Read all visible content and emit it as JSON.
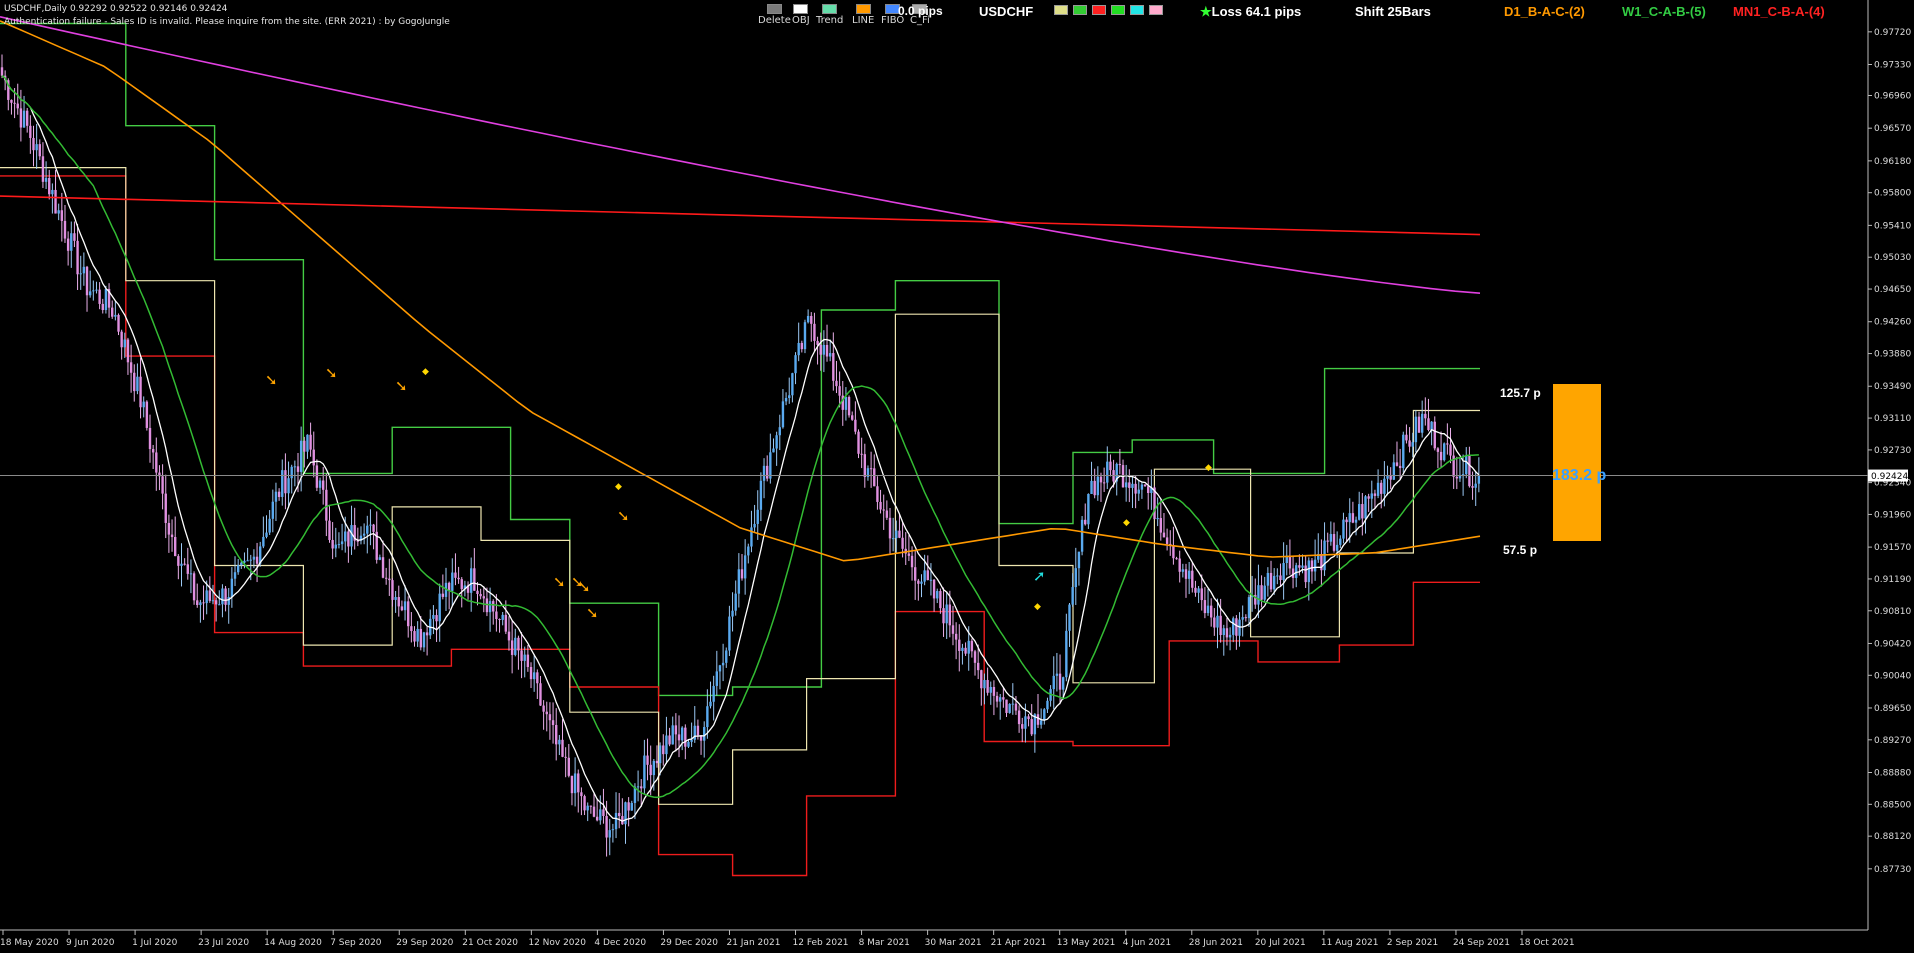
{
  "header": {
    "symbol_line": "USDCHF,Daily  0.92292 0.92522 0.92146 0.92424",
    "auth_message": "Authentication failure - Sales ID is invalid. Please inquire from the site. (ERR 2021) : by GogoJungle"
  },
  "toolbar": {
    "tools": [
      {
        "label": "Delete",
        "color": "#7a7a7a"
      },
      {
        "label": "OBJ",
        "color": "#ffffff"
      },
      {
        "label": "Trend",
        "color": "#66ddaa"
      },
      {
        "label": "LINE",
        "color": "#ff9900"
      },
      {
        "label": "FIBO",
        "color": "#4488ff"
      },
      {
        "label": "C_Fi",
        "color": "#aaaaaa"
      }
    ],
    "pips": "0.0 pips",
    "symbol": "USDCHF",
    "swatches": [
      "#dede88",
      "#33cc33",
      "#ff2020",
      "#22dd22",
      "#22e5e5",
      "#ffaacc"
    ],
    "loss_icon": "star-icon",
    "loss": "Loss 64.1 pips",
    "shift": "Shift 25Bars",
    "d1": "D1_B-A-C-(2)",
    "w1": "W1_C-A-B-(5)",
    "mn1": "MN1_C-B-A-(4)",
    "colors": {
      "d1": "#ff9900",
      "w1": "#33cc44",
      "mn1": "#ff2222"
    }
  },
  "chart_data": {
    "type": "candlestick",
    "title": "USDCHF,Daily",
    "ylim": [
      0.87,
      0.981
    ],
    "y_ticks": [
      "0.97720",
      "0.97330",
      "0.96960",
      "0.96570",
      "0.96180",
      "0.95800",
      "0.95410",
      "0.95030",
      "0.94650",
      "0.94260",
      "0.93880",
      "0.93490",
      "0.93110",
      "0.92730",
      "0.92340",
      "0.91960",
      "0.91570",
      "0.91190",
      "0.90810",
      "0.90420",
      "0.90040",
      "0.89650",
      "0.89270",
      "0.88880",
      "0.88500",
      "0.88120",
      "0.87730"
    ],
    "x_ticks": [
      "18 May 2020",
      "9 Jun 2020",
      "1 Jul 2020",
      "23 Jul 2020",
      "14 Aug 2020",
      "7 Sep 2020",
      "29 Sep 2020",
      "21 Oct 2020",
      "12 Nov 2020",
      "4 Dec 2020",
      "29 Dec 2020",
      "21 Jan 2021",
      "12 Feb 2021",
      "8 Mar 2021",
      "30 Mar 2021",
      "21 Apr 2021",
      "13 May 2021",
      "4 Jun 2021",
      "28 Jun 2021",
      "20 Jul 2021",
      "11 Aug 2021",
      "2 Sep 2021",
      "24 Sep 2021",
      "18 Oct 2021"
    ],
    "current_price": "0.92424",
    "ohlc_last": {
      "open": 0.92292,
      "high": 0.92522,
      "low": 0.92146,
      "close": 0.92424
    },
    "close_path": [
      0.972,
      0.965,
      0.956,
      0.947,
      0.944,
      0.933,
      0.918,
      0.909,
      0.91,
      0.914,
      0.923,
      0.928,
      0.915,
      0.919,
      0.911,
      0.905,
      0.911,
      0.912,
      0.906,
      0.9,
      0.891,
      0.884,
      0.882,
      0.889,
      0.893,
      0.893,
      0.905,
      0.92,
      0.932,
      0.943,
      0.935,
      0.925,
      0.917,
      0.912,
      0.907,
      0.901,
      0.897,
      0.895,
      0.9,
      0.923,
      0.925,
      0.923,
      0.916,
      0.909,
      0.905,
      0.91,
      0.914,
      0.913,
      0.917,
      0.921,
      0.926,
      0.931,
      0.926,
      0.924
    ],
    "series": [
      {
        "name": "MN1_C-B-A-(4)",
        "values": [
          0.9576,
          0.953
        ]
      },
      {
        "name": "D1_B-A-C-(2)",
        "values": [
          0.9785,
          0.973,
          0.964,
          0.953,
          0.942,
          0.932,
          0.925,
          0.918,
          0.914,
          0.916,
          0.918,
          0.916,
          0.9145,
          0.915,
          0.917
        ]
      },
      {
        "name": "W1_C-A-B-(5)",
        "values": [
          0.978,
          0.946
        ]
      }
    ],
    "labels": {
      "upper": "125.7 p",
      "middle": "183.2 p",
      "lower": "57.5 p"
    },
    "grid": false
  }
}
